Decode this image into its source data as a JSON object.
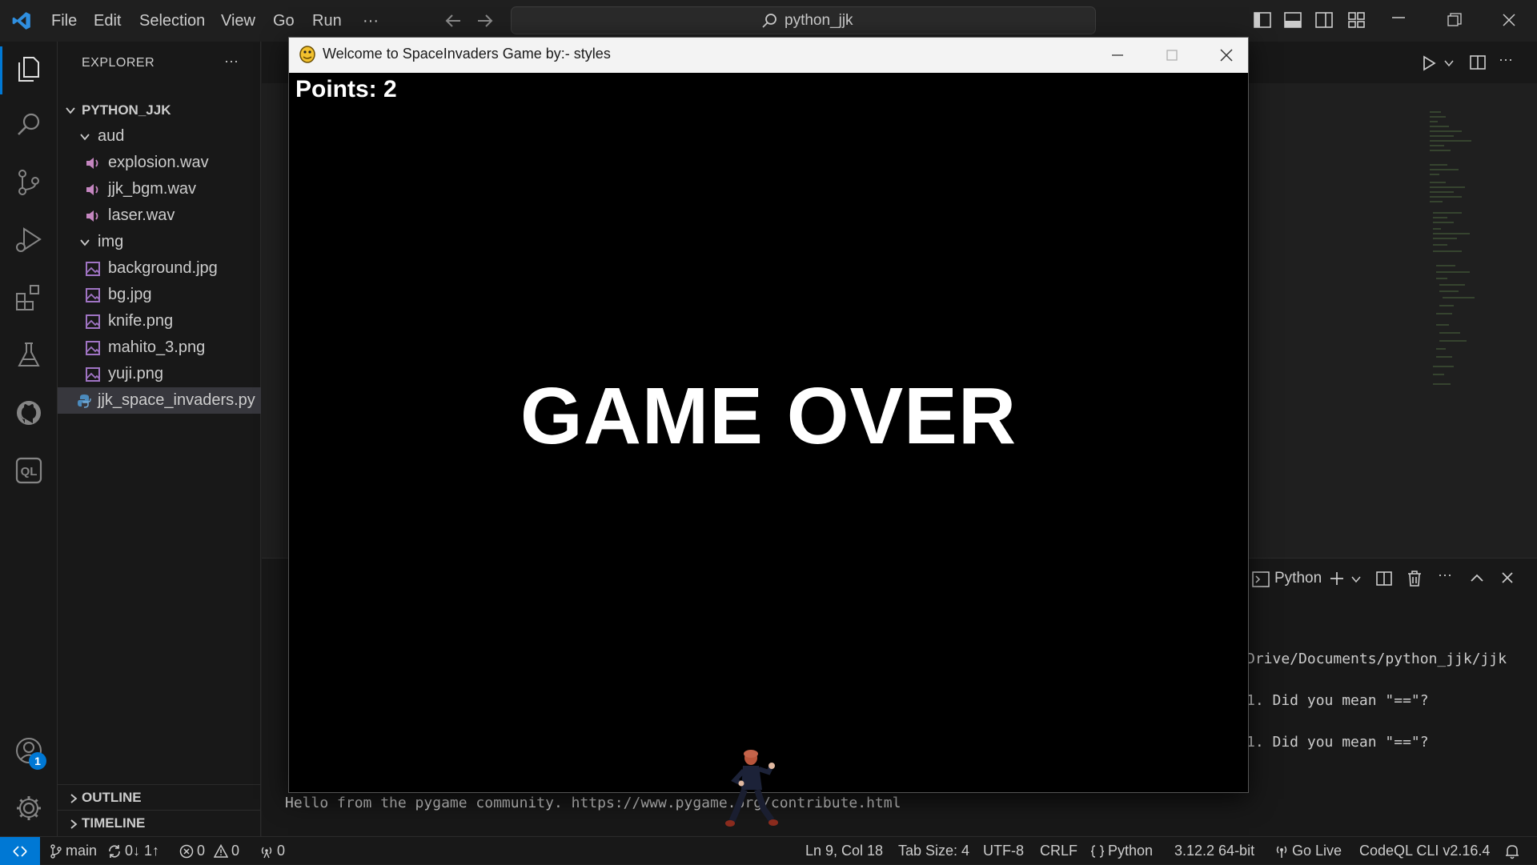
{
  "titlebar": {
    "menus": [
      "File",
      "Edit",
      "Selection",
      "View",
      "Go",
      "Run",
      "···"
    ],
    "search": "python_jjk"
  },
  "sidebar": {
    "title": "EXPLORER",
    "more": "···",
    "root": "PYTHON_JJK",
    "folders": [
      {
        "name": "aud",
        "files": [
          "explosion.wav",
          "jjk_bgm.wav",
          "laser.wav"
        ]
      },
      {
        "name": "img",
        "files": [
          "background.jpg",
          "bg.jpg",
          "knife.png",
          "mahito_3.png",
          "yuji.png"
        ]
      }
    ],
    "py_file": "jjk_space_invaders.py",
    "outline": "OUTLINE",
    "timeline": "TIMELINE"
  },
  "activity_badge": "1",
  "game": {
    "title": "Welcome to SpaceInvaders Game by:- styles",
    "points": "Points: 2",
    "status": "GAME OVER"
  },
  "terminal": {
    "label": "Python",
    "lines": [
      "Drive/Documents/python_jjk/jjk",
      "1. Did you mean \"==\"?",
      "1. Did you mean \"==\"?"
    ],
    "hello": "Hello from the pygame community. https://www.pygame.org/contribute.html"
  },
  "statusbar": {
    "branch": "main",
    "sync": "0↓ 1↑",
    "errors": "0",
    "warnings": "0",
    "ports": "0",
    "position": "Ln 9, Col 18",
    "tab_size": "Tab Size: 4",
    "encoding": "UTF-8",
    "eol": "CRLF",
    "language": "Python",
    "interpreter": "3.12.2 64-bit",
    "go_live": "Go Live",
    "codeql": "CodeQL CLI v2.16.4"
  },
  "colors": {
    "accent": "#0078d4",
    "background": "#1f1f1f",
    "sidebar": "#181818",
    "file_icon_audio": "#c586c0",
    "file_icon_image": "#a074c4",
    "python_icon": "#4b8bbe"
  }
}
